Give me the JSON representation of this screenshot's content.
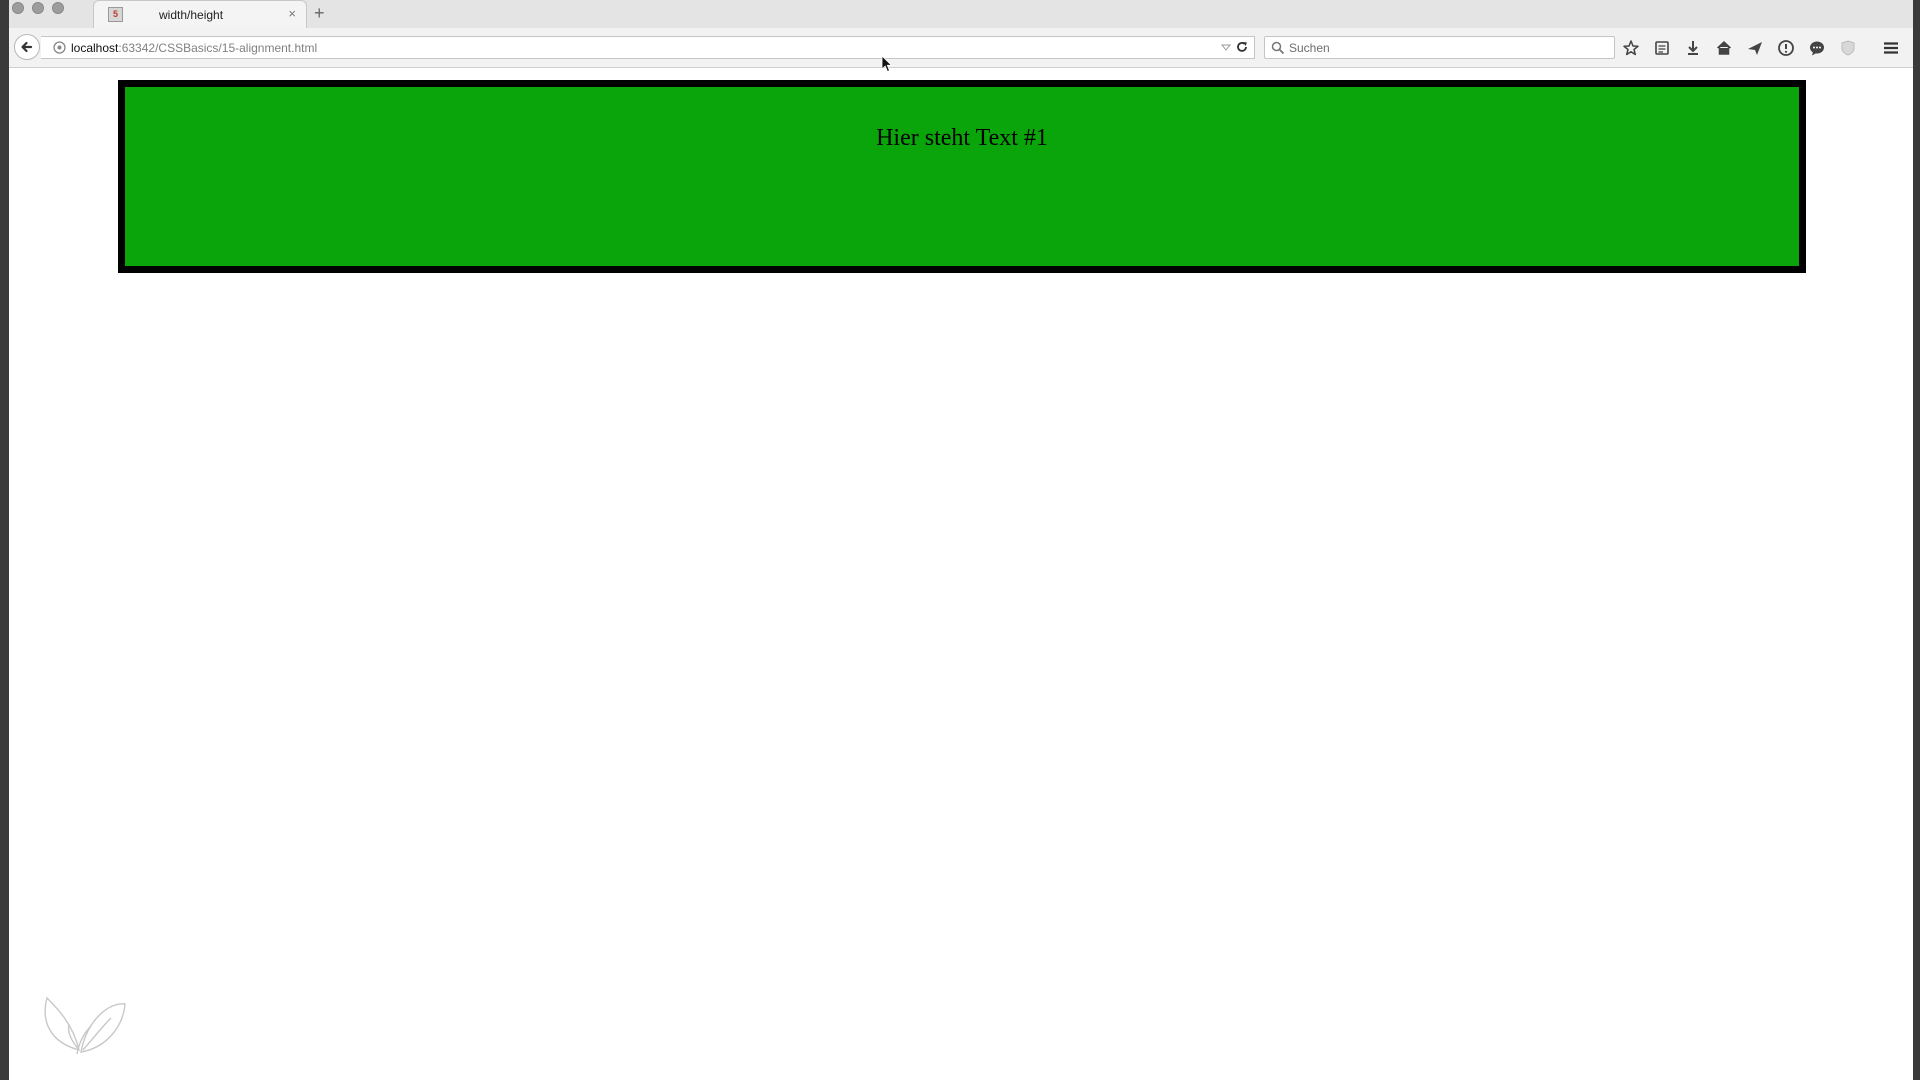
{
  "tab": {
    "title": "width/height",
    "close": "×"
  },
  "newtab": "+",
  "address": {
    "host": "localhost",
    "path": ":63342/CSSBasics/15-alignment.html"
  },
  "search": {
    "placeholder": "Suchen"
  },
  "page": {
    "box_text": "Hier steht Text #1"
  },
  "colors": {
    "box_fill": "#0aa50a",
    "box_border": "#000000"
  },
  "icons": [
    "back-arrow-icon",
    "site-info-icon",
    "dropdown-icon",
    "reload-icon",
    "search-icon",
    "bookmark-star-icon",
    "reading-list-icon",
    "download-icon",
    "home-icon",
    "send-icon",
    "info-icon",
    "chat-icon",
    "shield-icon",
    "menu-icon"
  ]
}
